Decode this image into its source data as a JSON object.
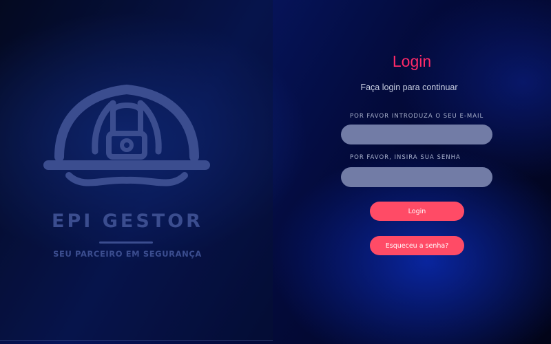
{
  "brand": {
    "title": "EPI GESTOR",
    "tagline": "SEU PARCEIRO EM SEGURANÇA",
    "logo_icon": "hard-hat-icon",
    "color": "#3b4d8f"
  },
  "login": {
    "title": "Login",
    "subtitle": "Faça login para continuar",
    "email_label": "POR FAVOR INTRODUZA O SEU E-MAIL",
    "email_value": "",
    "password_label": "POR FAVOR, INSIRA SUA SENHA",
    "password_value": "",
    "login_button": "Login",
    "forgot_button": "Esqueceu a senha?"
  },
  "colors": {
    "accent": "#ff2a68",
    "button": "#ff4b66",
    "input_bg": "#727ca6",
    "background": "#06145a"
  }
}
